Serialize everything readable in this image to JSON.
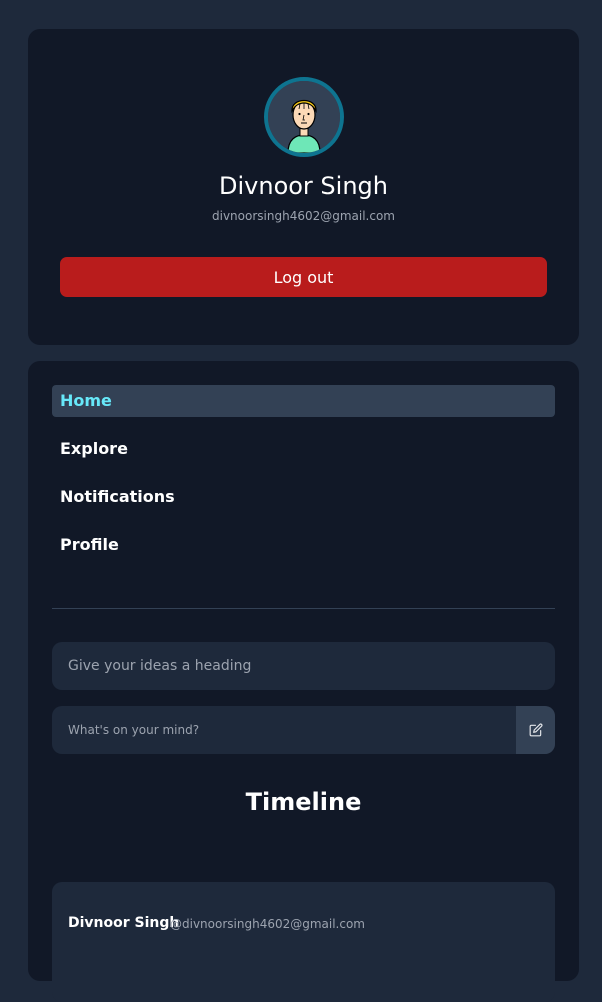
{
  "profile": {
    "name": "Divnoor Singh",
    "email": "divnoorsingh4602@gmail.com",
    "avatar_icon": "user-avatar-icon",
    "logout_label": "Log out"
  },
  "nav": {
    "items": [
      {
        "label": "Home",
        "active": true
      },
      {
        "label": "Explore",
        "active": false
      },
      {
        "label": "Notifications",
        "active": false
      },
      {
        "label": "Profile",
        "active": false
      }
    ]
  },
  "composer": {
    "heading_placeholder": "Give your ideas a heading",
    "body_placeholder": "What's on your mind?",
    "submit_icon": "edit-icon"
  },
  "timeline": {
    "title": "Timeline",
    "posts": [
      {
        "author": "Divnoor Singh",
        "handle": "@divnoorsingh4602@gmail.com"
      }
    ]
  },
  "colors": {
    "page_bg": "#1e293b",
    "card_bg": "#111827",
    "accent": "#67e8f9",
    "danger": "#b91c1c"
  }
}
